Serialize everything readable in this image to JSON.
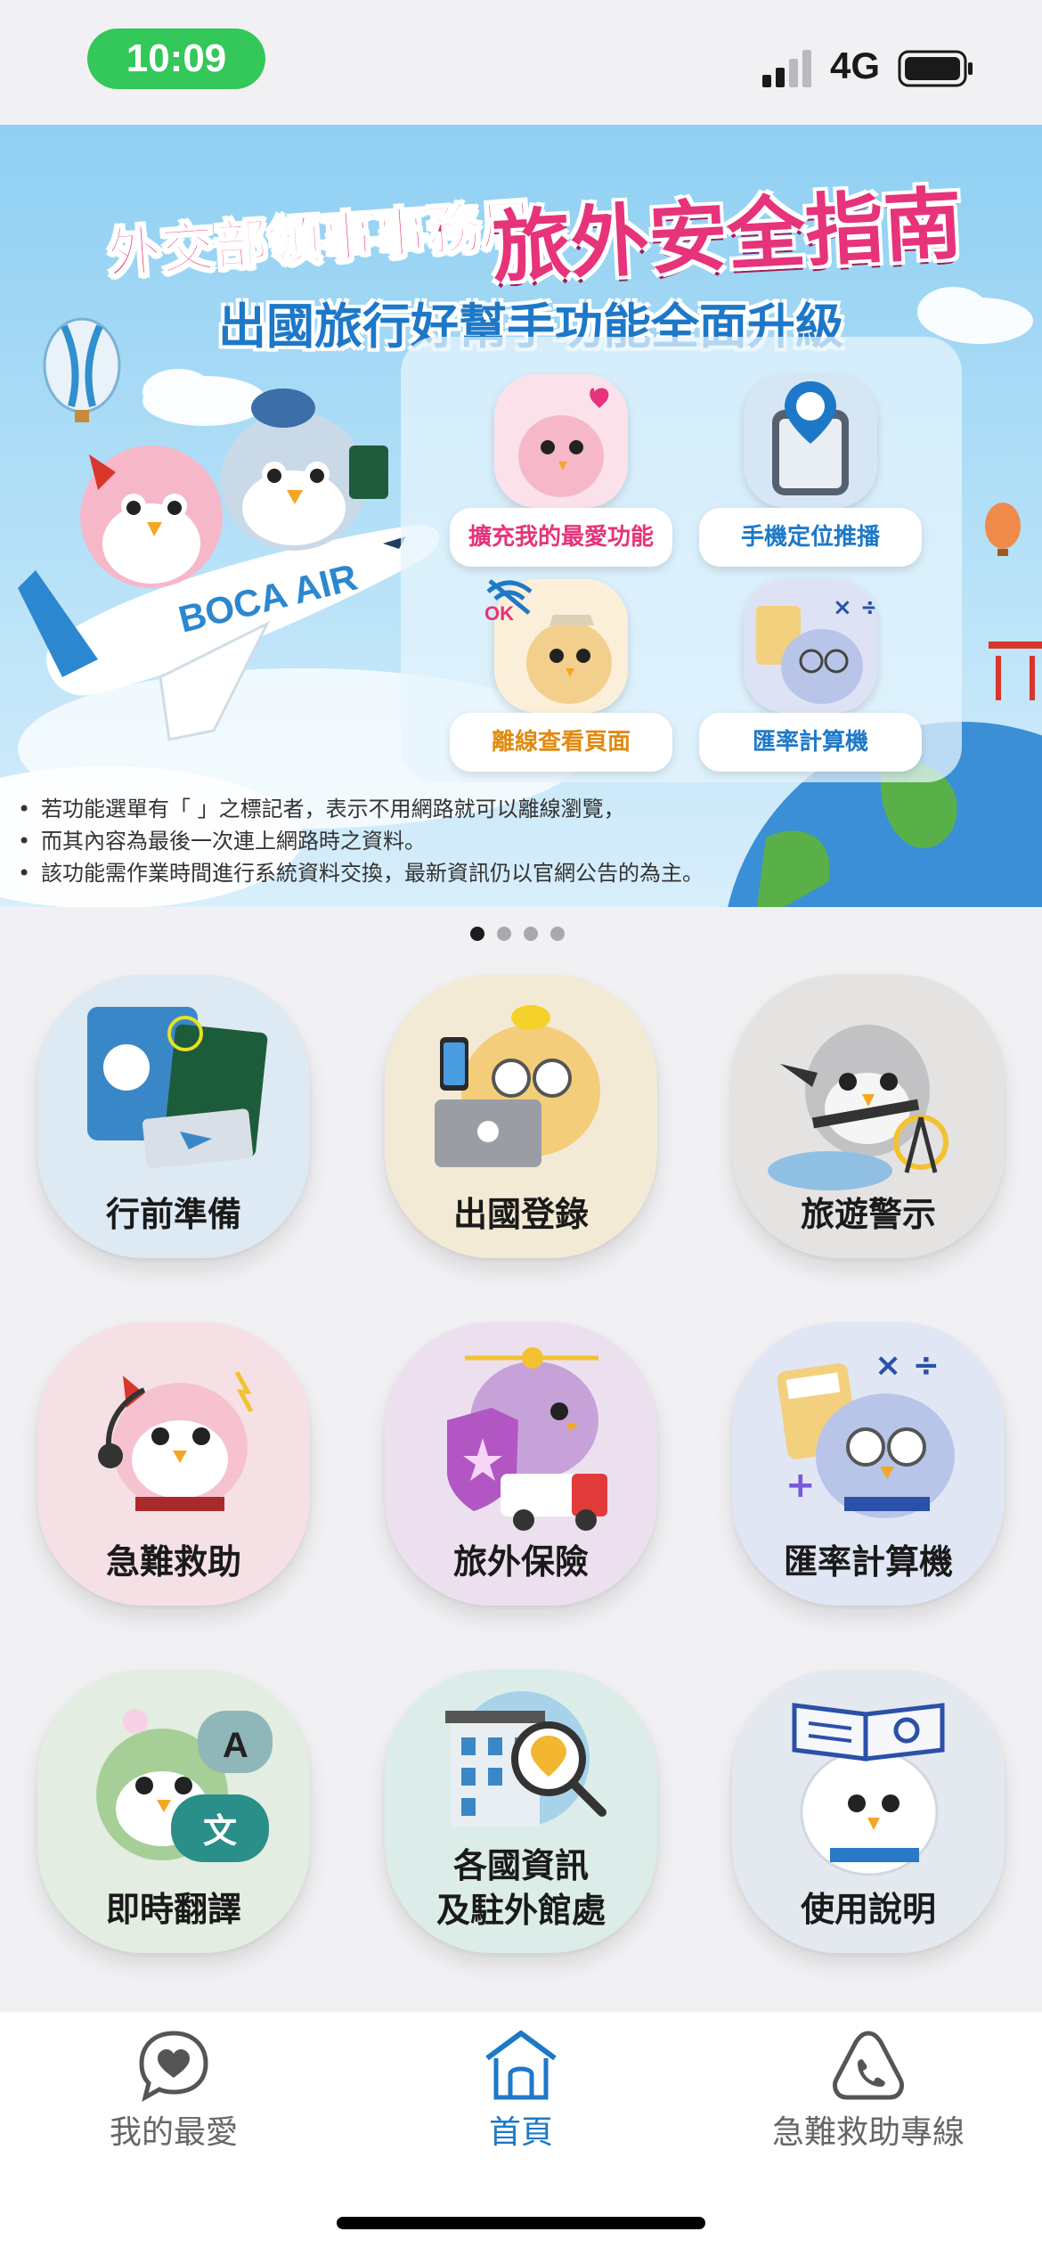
{
  "status_bar": {
    "time": "10:09",
    "network": "4G"
  },
  "banner": {
    "title_small": "外交部領事事務局",
    "title_large": "旅外安全指南",
    "subtitle": "出國旅行好幫手功能全面升級",
    "plane_text": "BOCA AIR",
    "ok_badge": "OK",
    "features": [
      {
        "label": "擴充我的最愛功能",
        "icon": "heart-owl-icon"
      },
      {
        "label": "手機定位推播",
        "icon": "location-pin-icon"
      },
      {
        "label": "離線查看頁面",
        "icon": "offline-ok-icon"
      },
      {
        "label": "匯率計算機",
        "icon": "calculator-icon"
      }
    ],
    "notes": [
      "若功能選單有「 」之標記者，表示不用網路就可以離線瀏覽，",
      "而其內容為最後一次連上網路時之資料。",
      "該功能需作業時間進行系統資料交換，最新資訊仍以官網公告的為主。"
    ],
    "page_count": 4,
    "active_page": 1
  },
  "grid": [
    {
      "label": "行前準備",
      "icon": "passport-icon",
      "bg": "#dde9f3"
    },
    {
      "label": "出國登錄",
      "icon": "laptop-owl-icon",
      "bg": "#f3ead6"
    },
    {
      "label": "旅遊警示",
      "icon": "warning-owl-icon",
      "bg": "#e4e3e1"
    },
    {
      "label": "急難救助",
      "icon": "headset-owl-icon",
      "bg": "#f5e1e5"
    },
    {
      "label": "旅外保險",
      "icon": "insurance-shield-icon",
      "bg": "#ece0ef"
    },
    {
      "label": "匯率計算機",
      "icon": "calculator-owl-icon",
      "bg": "#e1e6f4"
    },
    {
      "label": "即時翻譯",
      "icon": "translate-icon",
      "bg": "#e3ede2"
    },
    {
      "label_line1": "各國資訊",
      "label_line2": "及駐外館處",
      "icon": "embassy-search-icon",
      "bg": "#dcede9"
    },
    {
      "label": "使用說明",
      "icon": "manual-book-icon",
      "bg": "#e4e8ef"
    }
  ],
  "bottom_nav": {
    "favorites": "我的最愛",
    "home": "首頁",
    "emergency": "急難救助專線"
  },
  "colors": {
    "accent": "#1e78c8",
    "pink": "#e6337a",
    "status_green": "#34c759"
  }
}
